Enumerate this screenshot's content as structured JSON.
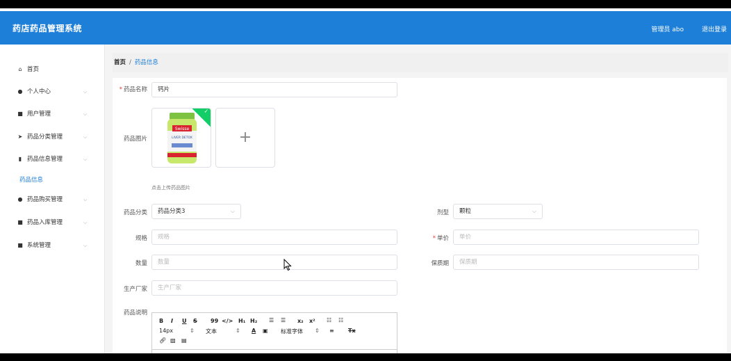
{
  "header": {
    "title": "药店药品管理系统",
    "user": "管理员 abo",
    "logout": "退出登录"
  },
  "sidebar": {
    "items": [
      {
        "label": "首页",
        "icon": "home-icon"
      },
      {
        "label": "个人中心",
        "icon": "user-icon"
      },
      {
        "label": "用户管理",
        "icon": "grid-icon"
      },
      {
        "label": "药品分类管理",
        "icon": "send-icon"
      },
      {
        "label": "药品信息管理",
        "icon": "document-icon"
      },
      {
        "label": "药品购买管理",
        "icon": "user-icon"
      },
      {
        "label": "药品入库管理",
        "icon": "grid-icon"
      },
      {
        "label": "系统管理",
        "icon": "grid-icon"
      }
    ],
    "subitem": "药品信息"
  },
  "breadcrumb": {
    "home": "首页",
    "separator": "/",
    "current": "药品信息"
  },
  "form": {
    "name": {
      "label": "药品名称",
      "value": "钙片",
      "required": true
    },
    "image": {
      "label": "药品图片",
      "hint": "点击上传药品图片",
      "plus": "+"
    },
    "category": {
      "label": "药品分类",
      "value": "药品分类3"
    },
    "dosage": {
      "label": "剂型",
      "value": "颗粒"
    },
    "spec": {
      "label": "规格",
      "placeholder": "规格"
    },
    "price": {
      "label": "单价",
      "placeholder": "单价",
      "required": true
    },
    "qty": {
      "label": "数量",
      "placeholder": "数量"
    },
    "shelf": {
      "label": "保质期",
      "placeholder": "保质期"
    },
    "maker": {
      "label": "生产厂家",
      "placeholder": "生产厂家"
    },
    "desc": {
      "label": "药品说明"
    }
  },
  "editor": {
    "fontsize": "14px",
    "textstyle": "文本",
    "fontfamily": "标准字体",
    "b": "B",
    "i": "I",
    "u": "U",
    "s": "S",
    "quote": "99",
    "code": "</>",
    "h1": "H₁",
    "h2": "H₂",
    "sub": "x₂",
    "sup": "x²",
    "clean": "Tx"
  },
  "product_image": {
    "brand": "Swisse",
    "product": "LIVER DETOX"
  },
  "colors": {
    "primary": "#1e7fd8",
    "success": "#13ce66",
    "required": "#e53935"
  }
}
